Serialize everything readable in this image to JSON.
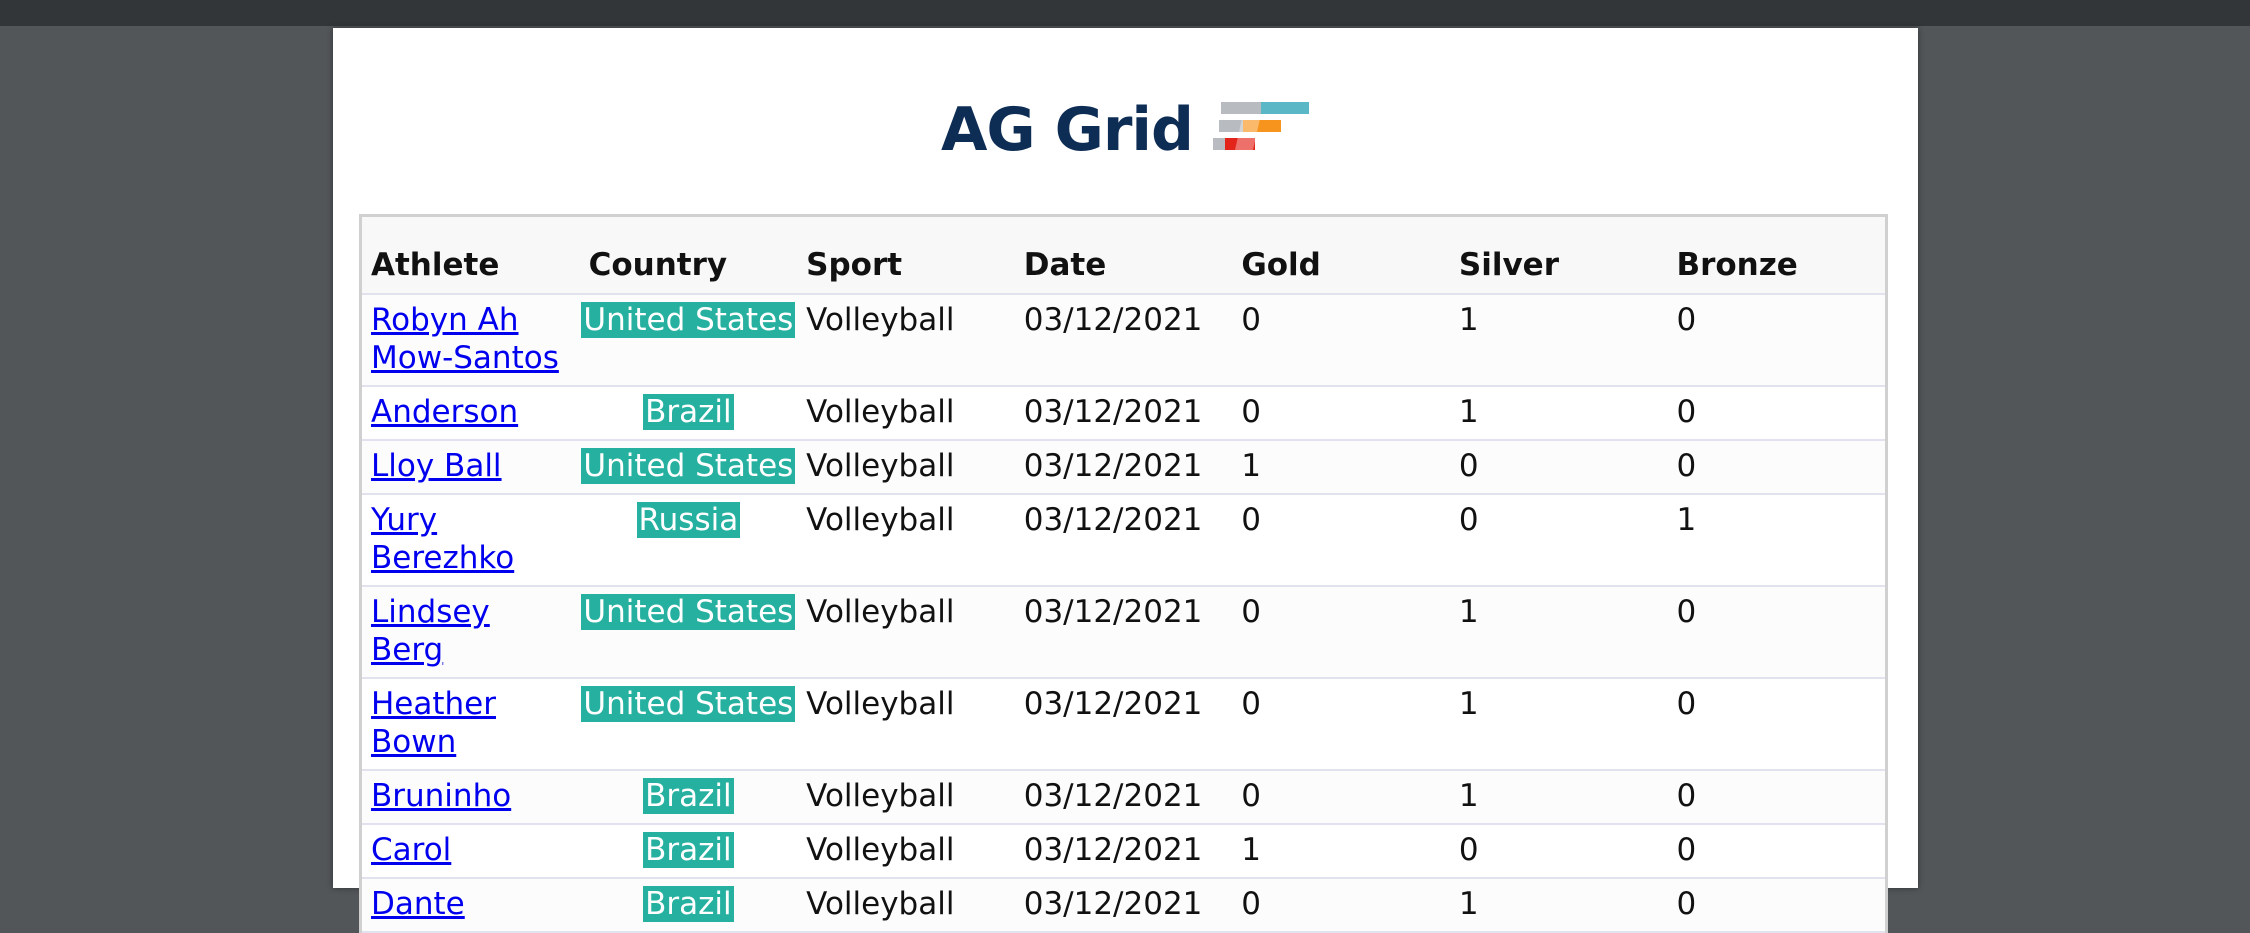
{
  "logo": {
    "text": "AG Grid"
  },
  "grid": {
    "columns": [
      "Athlete",
      "Country",
      "Sport",
      "Date",
      "Gold",
      "Silver",
      "Bronze"
    ],
    "rows": [
      {
        "athlete": "Robyn Ah Mow-Santos",
        "country": "United States",
        "sport": "Volleyball",
        "date": "03/12/2021",
        "gold": "0",
        "silver": "1",
        "bronze": "0"
      },
      {
        "athlete": "Anderson",
        "country": "Brazil",
        "sport": "Volleyball",
        "date": "03/12/2021",
        "gold": "0",
        "silver": "1",
        "bronze": "0"
      },
      {
        "athlete": "Lloy Ball",
        "country": "United States",
        "sport": "Volleyball",
        "date": "03/12/2021",
        "gold": "1",
        "silver": "0",
        "bronze": "0"
      },
      {
        "athlete": "Yury Berezhko",
        "country": "Russia",
        "sport": "Volleyball",
        "date": "03/12/2021",
        "gold": "0",
        "silver": "0",
        "bronze": "1"
      },
      {
        "athlete": "Lindsey Berg",
        "country": "United States",
        "sport": "Volleyball",
        "date": "03/12/2021",
        "gold": "0",
        "silver": "1",
        "bronze": "0"
      },
      {
        "athlete": "Heather Bown",
        "country": "United States",
        "sport": "Volleyball",
        "date": "03/12/2021",
        "gold": "0",
        "silver": "1",
        "bronze": "0"
      },
      {
        "athlete": "Bruninho",
        "country": "Brazil",
        "sport": "Volleyball",
        "date": "03/12/2021",
        "gold": "0",
        "silver": "1",
        "bronze": "0"
      },
      {
        "athlete": "Carol",
        "country": "Brazil",
        "sport": "Volleyball",
        "date": "03/12/2021",
        "gold": "1",
        "silver": "0",
        "bronze": "0"
      },
      {
        "athlete": "Dante",
        "country": "Brazil",
        "sport": "Volleyball",
        "date": "03/12/2021",
        "gold": "0",
        "silver": "1",
        "bronze": "0"
      }
    ]
  },
  "colors": {
    "badge": "#26b0a0",
    "logo_text": "#0e2d55",
    "link": "#0000ee"
  }
}
